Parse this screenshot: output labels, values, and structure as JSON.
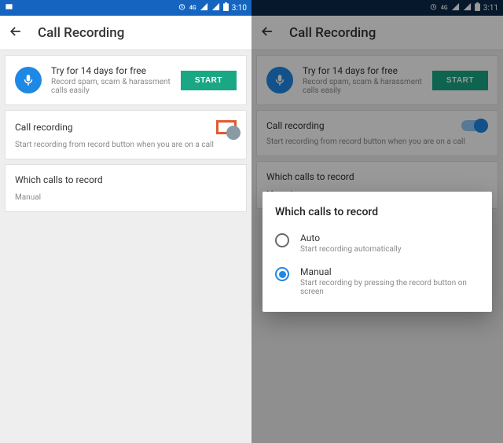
{
  "left": {
    "status": {
      "time": "3:10",
      "net": "4G"
    },
    "appbar": {
      "title": "Call Recording"
    },
    "promo": {
      "title": "Try for 14 days for free",
      "sub": "Record spam, scam & harassment calls easily",
      "button": "START"
    },
    "setting": {
      "title": "Call recording",
      "sub": "Start recording from record button when you are on a call",
      "on": false
    },
    "section": {
      "title": "Which calls to record",
      "value": "Manual"
    }
  },
  "right": {
    "status": {
      "time": "3:11",
      "net": "4G"
    },
    "appbar": {
      "title": "Call Recording"
    },
    "promo": {
      "title": "Try for 14 days for free",
      "sub": "Record spam, scam & harassment calls easily",
      "button": "START"
    },
    "setting": {
      "title": "Call recording",
      "sub": "Start recording from record button when you are on a call",
      "on": true
    },
    "section": {
      "title": "Which calls to record",
      "value": "Manual"
    },
    "dialog": {
      "title": "Which calls to record",
      "options": [
        {
          "label": "Auto",
          "sub": "Start recording automatically",
          "selected": false
        },
        {
          "label": "Manual",
          "sub": "Start recording by pressing the record button on screen",
          "selected": true
        }
      ]
    }
  }
}
